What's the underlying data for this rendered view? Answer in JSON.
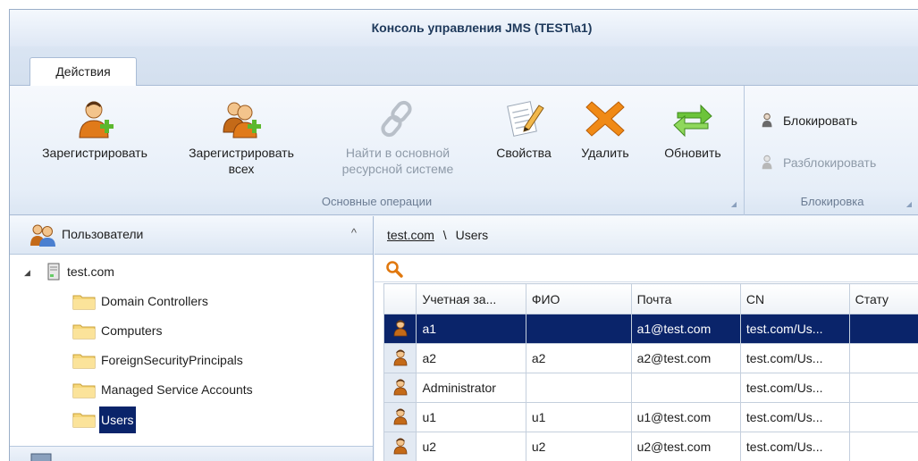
{
  "window": {
    "title": "Консоль управления JMS (TEST\\a1)"
  },
  "ribbon": {
    "tab": "Действия",
    "main_group": {
      "label": "Основные операции",
      "buttons": [
        {
          "label_line1": "Зарегистрировать",
          "label_line2": "",
          "icon": "user-add-icon",
          "disabled": false
        },
        {
          "label_line1": "Зарегистрировать",
          "label_line2": "всех",
          "icon": "users-add-icon",
          "disabled": false
        },
        {
          "label_line1": "Найти в основной",
          "label_line2": "ресурсной системе",
          "icon": "link-icon",
          "disabled": true
        },
        {
          "label_line1": "Свойства",
          "label_line2": "",
          "icon": "edit-pencil-icon",
          "disabled": false
        },
        {
          "label_line1": "Удалить",
          "label_line2": "",
          "icon": "delete-x-icon",
          "disabled": false
        },
        {
          "label_line1": "Обновить",
          "label_line2": "",
          "icon": "refresh-icon",
          "disabled": false
        }
      ]
    },
    "lock_group": {
      "label": "Блокировка",
      "block": "Блокировать",
      "unblock": "Разблокировать"
    },
    "accent_color": "#f08a16"
  },
  "left_pane": {
    "header": "Пользователи",
    "tree": {
      "root": "test.com",
      "children": [
        "Domain Controllers",
        "Computers",
        "ForeignSecurityPrincipals",
        "Managed Service Accounts",
        "Users"
      ],
      "selected": "Users"
    }
  },
  "right_pane": {
    "breadcrumb": {
      "root": "test.com",
      "separator": "\\",
      "current": "Users"
    },
    "columns": [
      "Учетная за...",
      "ФИО",
      "Почта",
      "CN",
      "Стату"
    ],
    "rows": [
      {
        "account": "a1",
        "fio": "",
        "mail": "a1@test.com",
        "cn": "test.com/Us...",
        "status": "",
        "selected": true
      },
      {
        "account": "a2",
        "fio": "a2",
        "mail": "a2@test.com",
        "cn": "test.com/Us...",
        "status": "",
        "selected": false
      },
      {
        "account": "Administrator",
        "fio": "",
        "mail": "",
        "cn": "test.com/Us...",
        "status": "",
        "selected": false
      },
      {
        "account": "u1",
        "fio": "u1",
        "mail": "u1@test.com",
        "cn": "test.com/Us...",
        "status": "",
        "selected": false
      },
      {
        "account": "u2",
        "fio": "u2",
        "mail": "u2@test.com",
        "cn": "test.com/Us...",
        "status": "",
        "selected": false
      }
    ],
    "selection_color": "#0a246a"
  }
}
